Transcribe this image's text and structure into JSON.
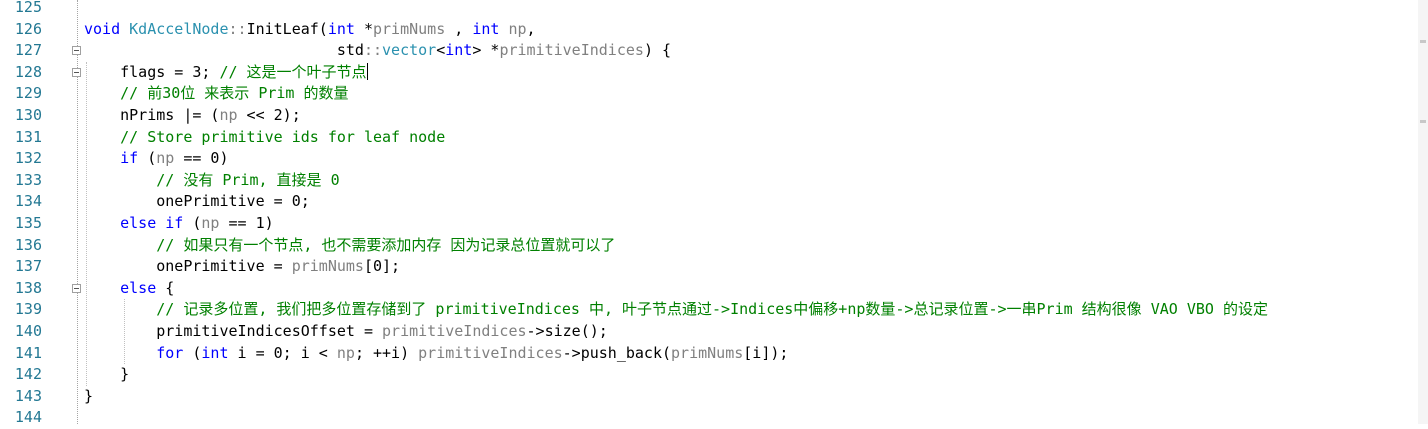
{
  "editor": {
    "lines": [
      {
        "n": "125",
        "tokens": []
      },
      {
        "n": "126",
        "tokens": [
          [
            "kw",
            "void "
          ],
          [
            "ty",
            "KdAccelNode"
          ],
          [
            "pm",
            "::"
          ],
          [
            "",
            "InitLeaf("
          ],
          [
            "kw",
            "int "
          ],
          [
            "",
            "*"
          ],
          [
            "pm",
            "primNums"
          ],
          [
            "",
            " , "
          ],
          [
            "kw",
            "int "
          ],
          [
            "pm",
            "np"
          ],
          [
            "",
            ","
          ]
        ]
      },
      {
        "n": "127",
        "tokens": [
          [
            "",
            "                            std"
          ],
          [
            "pm",
            "::"
          ],
          [
            "ty",
            "vector"
          ],
          [
            "",
            "<"
          ],
          [
            "kw",
            "int"
          ],
          [
            "",
            "> *"
          ],
          [
            "pm",
            "primitiveIndices"
          ],
          [
            "",
            ") {"
          ]
        ]
      },
      {
        "n": "128",
        "tokens": [
          [
            "",
            "    flags = 3; "
          ],
          [
            "cm",
            "// 这是一个叶子节点"
          ]
        ]
      },
      {
        "n": "129",
        "tokens": [
          [
            "",
            "    "
          ],
          [
            "cm",
            "// 前30位 来表示 Prim 的数量"
          ]
        ]
      },
      {
        "n": "130",
        "tokens": [
          [
            "",
            "    nPrims |= ("
          ],
          [
            "pm",
            "np"
          ],
          [
            "",
            " << 2);"
          ]
        ]
      },
      {
        "n": "131",
        "tokens": [
          [
            "",
            "    "
          ],
          [
            "cm",
            "// Store primitive ids for leaf node"
          ]
        ]
      },
      {
        "n": "132",
        "tokens": [
          [
            "",
            "    "
          ],
          [
            "kw",
            "if "
          ],
          [
            "",
            "("
          ],
          [
            "pm",
            "np"
          ],
          [
            "",
            " == 0)"
          ]
        ]
      },
      {
        "n": "133",
        "tokens": [
          [
            "",
            "        "
          ],
          [
            "cm",
            "// 没有 Prim, 直接是 0"
          ]
        ]
      },
      {
        "n": "134",
        "tokens": [
          [
            "",
            "        onePrimitive = 0;"
          ]
        ]
      },
      {
        "n": "135",
        "tokens": [
          [
            "",
            "    "
          ],
          [
            "kw",
            "else if "
          ],
          [
            "",
            "("
          ],
          [
            "pm",
            "np"
          ],
          [
            "",
            " == 1)"
          ]
        ]
      },
      {
        "n": "136",
        "tokens": [
          [
            "",
            "        "
          ],
          [
            "cm",
            "// 如果只有一个节点, 也不需要添加内存 因为记录总位置就可以了"
          ]
        ]
      },
      {
        "n": "137",
        "tokens": [
          [
            "",
            "        onePrimitive = "
          ],
          [
            "pm",
            "primNums"
          ],
          [
            "",
            "[0];"
          ]
        ]
      },
      {
        "n": "138",
        "tokens": [
          [
            "",
            "    "
          ],
          [
            "kw",
            "else "
          ],
          [
            "",
            "{"
          ]
        ]
      },
      {
        "n": "139",
        "tokens": [
          [
            "",
            "        "
          ],
          [
            "cm",
            "// 记录多位置, 我们把多位置存储到了 primitiveIndices 中, 叶子节点通过->Indices中偏移+np数量->总记录位置->一串Prim 结构很像 VAO VBO 的设定"
          ]
        ]
      },
      {
        "n": "140",
        "tokens": [
          [
            "",
            "        primitiveIndicesOffset = "
          ],
          [
            "pm",
            "primitiveIndices"
          ],
          [
            "",
            "->size();"
          ]
        ]
      },
      {
        "n": "141",
        "tokens": [
          [
            "",
            "        "
          ],
          [
            "kw",
            "for "
          ],
          [
            "",
            "("
          ],
          [
            "kw",
            "int "
          ],
          [
            "",
            "i = 0; i < "
          ],
          [
            "pm",
            "np"
          ],
          [
            "",
            "; ++i) "
          ],
          [
            "pm",
            "primitiveIndices"
          ],
          [
            "",
            "->push_back("
          ],
          [
            "pm",
            "primNums"
          ],
          [
            "",
            "[i]);"
          ]
        ]
      },
      {
        "n": "142",
        "tokens": [
          [
            "",
            "    }"
          ]
        ]
      },
      {
        "n": "143",
        "tokens": [
          [
            "",
            "}"
          ]
        ]
      },
      {
        "n": "144",
        "tokens": []
      }
    ],
    "fold_lines": [
      "127",
      "128",
      "138"
    ],
    "caret_line": "128"
  }
}
